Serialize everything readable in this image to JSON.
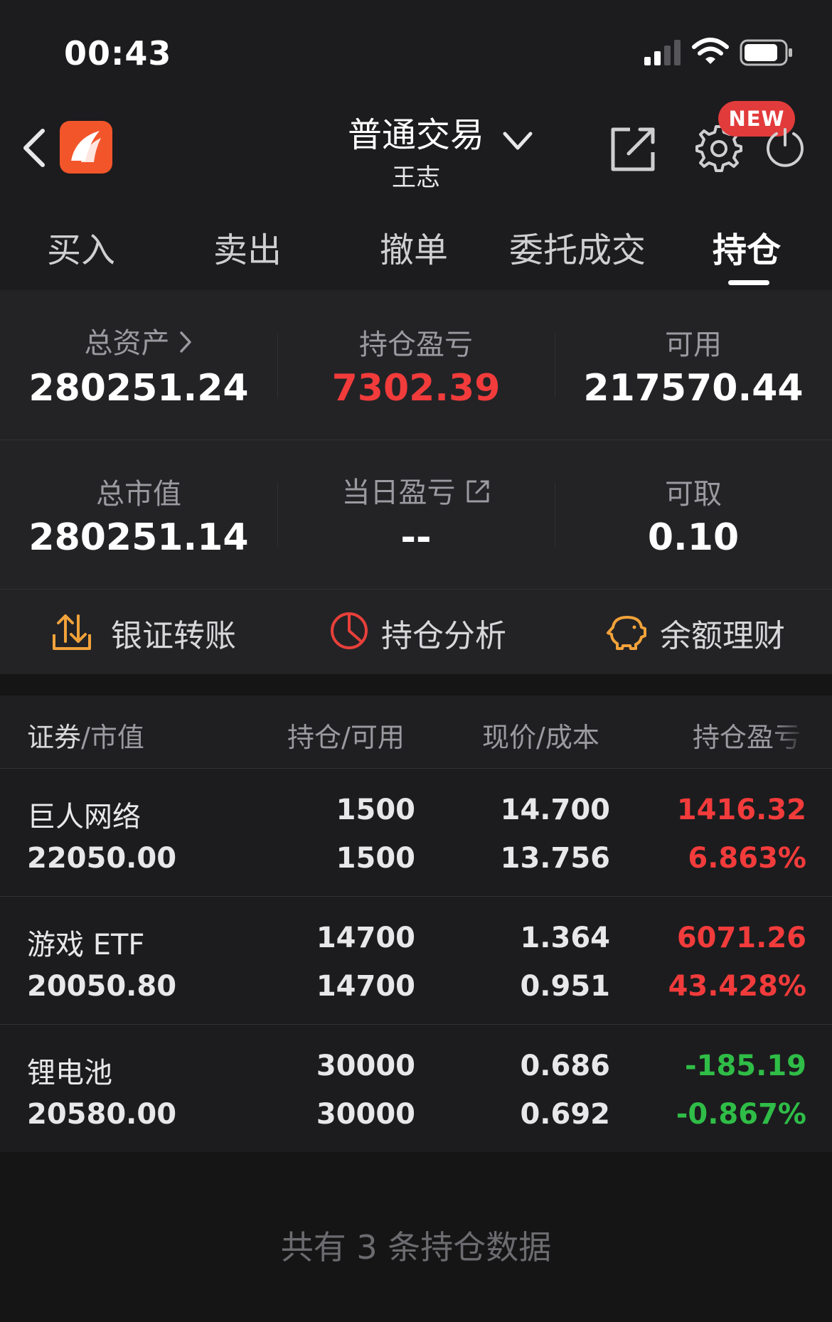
{
  "status_bar": {
    "time": "00:43"
  },
  "header": {
    "title": "普通交易",
    "subtitle": "王志",
    "badge": "NEW"
  },
  "tabs": [
    {
      "label": "买入"
    },
    {
      "label": "卖出"
    },
    {
      "label": "撤单"
    },
    {
      "label": "委托成交"
    },
    {
      "label": "持仓",
      "active": true
    }
  ],
  "summary": {
    "total_assets": {
      "label": "总资产",
      "value": "280251.24"
    },
    "position_pnl": {
      "label": "持仓盈亏",
      "value": "7302.39",
      "color": "#f23b3b"
    },
    "available": {
      "label": "可用",
      "value": "217570.44"
    },
    "market_value": {
      "label": "总市值",
      "value": "280251.14"
    },
    "daily_pnl": {
      "label": "当日盈亏",
      "value": "--"
    },
    "withdrawable": {
      "label": "可取",
      "value": "0.10"
    }
  },
  "actions": [
    {
      "label": "银证转账",
      "icon": "transfer-icon"
    },
    {
      "label": "持仓分析",
      "icon": "pie-chart-icon"
    },
    {
      "label": "余额理财",
      "icon": "piggy-bank-icon"
    }
  ],
  "table": {
    "columns": [
      {
        "main": "证券",
        "sep": "/",
        "sub": "市值"
      },
      {
        "main": "持仓",
        "sep": "/",
        "sub": "可用"
      },
      {
        "main": "现价",
        "sep": "/",
        "sub": "成本"
      },
      {
        "main": "持仓盈亏"
      }
    ],
    "rows": [
      {
        "name": "巨人网络",
        "market_value": "22050.00",
        "position": "1500",
        "available": "1500",
        "price": "14.700",
        "cost": "13.756",
        "pnl": "1416.32",
        "pnl_pct": "6.863%",
        "sign": "pos"
      },
      {
        "name": "游戏 ETF",
        "market_value": "20050.80",
        "position": "14700",
        "available": "14700",
        "price": "1.364",
        "cost": "0.951",
        "pnl": "6071.26",
        "pnl_pct": "43.428%",
        "sign": "pos"
      },
      {
        "name": "锂电池",
        "market_value": "20580.00",
        "position": "30000",
        "available": "30000",
        "price": "0.686",
        "cost": "0.692",
        "pnl": "-185.19",
        "pnl_pct": "-0.867%",
        "sign": "neg"
      }
    ]
  },
  "footer": {
    "text": "共有 3 条持仓数据"
  },
  "colors": {
    "up": "#f23b3b",
    "down": "#2fbd47",
    "brand": "#f3552a"
  }
}
